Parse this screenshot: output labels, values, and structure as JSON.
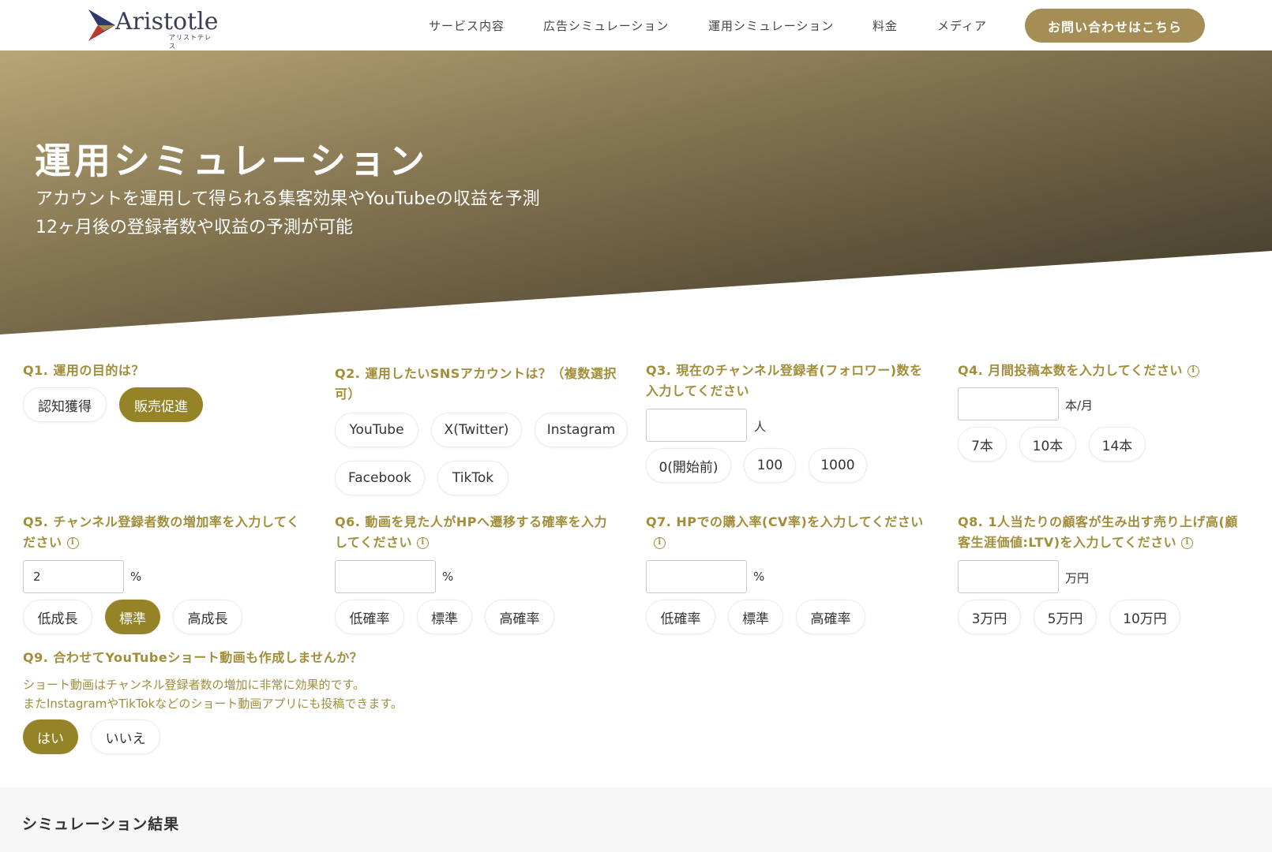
{
  "header": {
    "logo_text": "Aristotle",
    "logo_sub": "アリストテレス",
    "nav": [
      "サービス内容",
      "広告シミュレーション",
      "運用シミュレーション",
      "料金",
      "メディア"
    ],
    "contact_label": "お問い合わせはこちら"
  },
  "hero": {
    "title": "運用シミュレーション",
    "subtitle_1": "アカウントを運用して得られる集客効果やYouTubeの収益を予測",
    "subtitle_2": "12ヶ月後の登録者数や収益の予測が可能"
  },
  "questions": {
    "q1": {
      "title": "Q1. 運用の目的は？",
      "options": [
        "認知獲得",
        "販売促進"
      ],
      "selected": "販売促進"
    },
    "q2": {
      "title_1": "Q2. 運用したいSNSアカウントは？（複数選択",
      "title_2": "可）",
      "options": [
        "YouTube",
        "X(Twitter)",
        "Instagram",
        "Facebook",
        "TikTok"
      ]
    },
    "q3": {
      "title_1": "Q3. 現在のチャンネル登録者(フォロワー)数を",
      "title_2": "入力してください",
      "value": "",
      "unit": "人",
      "options": [
        "0(開始前)",
        "100",
        "1000"
      ]
    },
    "q4": {
      "title": "Q4. 月間投稿本数を入力してください",
      "value": "",
      "unit": "本/月",
      "options": [
        "7本",
        "10本",
        "14本"
      ]
    },
    "q5": {
      "title_1": "Q5. チャンネル登録者数の増加率を入力してく",
      "title_2": "ださい",
      "value": "2",
      "unit": "%",
      "options": [
        "低成長",
        "標準",
        "高成長"
      ],
      "selected": "標準"
    },
    "q6": {
      "title_1": "Q6. 動画を見た人がHPへ遷移する確率を入力",
      "title_2": "してください",
      "value": "",
      "unit": "%",
      "options": [
        "低確率",
        "標準",
        "高確率"
      ]
    },
    "q7": {
      "title": "Q7. HPでの購入率(CV率)を入力してください",
      "value": "",
      "unit": "%",
      "options": [
        "低確率",
        "標準",
        "高確率"
      ]
    },
    "q8": {
      "title_1": "Q8. 1人当たりの顧客が生み出す売り上げ高(顧",
      "title_2": "客生涯価値:LTV)を入力してください",
      "value": "",
      "unit": "万円",
      "options": [
        "3万円",
        "5万円",
        "10万円"
      ]
    },
    "q9": {
      "title": "Q9. 合わせてYouTubeショート動画も作成しませんか？",
      "desc_1": "ショート動画はチャンネル登録者数の増加に非常に効果的です。",
      "desc_2": "またInstagramやTikTokなどのショート動画アプリにも投稿できます。",
      "options": [
        "はい",
        "いいえ"
      ],
      "selected": "はい"
    }
  },
  "results": {
    "title": "シミュレーション結果"
  },
  "colors": {
    "accent": "#958427",
    "accent_text": "#a18d3a",
    "contact": "#a48e55"
  }
}
